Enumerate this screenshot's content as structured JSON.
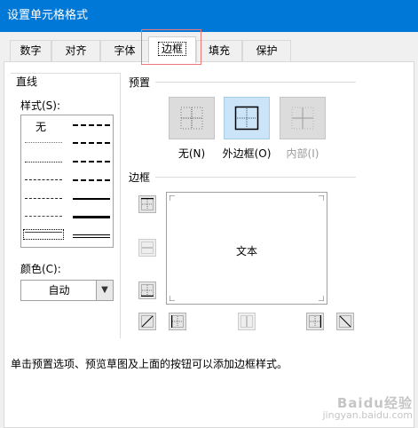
{
  "window": {
    "title": "设置单元格格式"
  },
  "tabs": [
    {
      "label": "数字"
    },
    {
      "label": "对齐"
    },
    {
      "label": "字体"
    },
    {
      "label": "边框"
    },
    {
      "label": "填充"
    },
    {
      "label": "保护"
    }
  ],
  "active_tab": "边框",
  "line": {
    "group_label": "直线",
    "style_label": "样式(S):",
    "none_label": "无",
    "color_label": "颜色(C):",
    "color_value": "自动"
  },
  "presets": {
    "label": "预置",
    "buttons": [
      {
        "label": "无(N)",
        "state": "normal"
      },
      {
        "label": "外边框(O)",
        "state": "selected"
      },
      {
        "label": "内部(I)",
        "state": "disabled"
      }
    ]
  },
  "border": {
    "label": "边框",
    "preview_text": "文本"
  },
  "hint": "单击预置选项、预览草图及上面的按钮可以添加边框样式。",
  "watermark": {
    "brand": "Baidu经验",
    "url": "jingyan.baidu.com"
  },
  "colors": {
    "titlebar": "#0078d7",
    "selected_preset": "#cce4f7",
    "tab_highlight": "#e8797a"
  }
}
